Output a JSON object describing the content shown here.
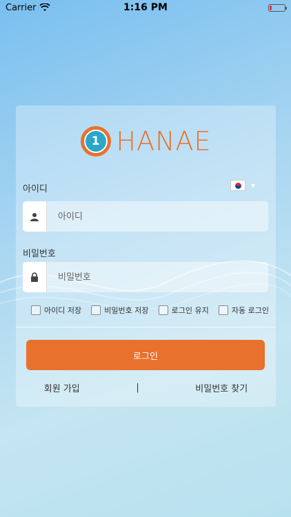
{
  "status_bar": {
    "carrier": "Carrier",
    "time": "1:16 PM",
    "wifi_icon": "wifi-icon",
    "battery_icon": "battery-icon"
  },
  "logo": {
    "number": "1",
    "text": "HANAE"
  },
  "form": {
    "id_label": "아이디",
    "id_placeholder": "아이디",
    "pw_label": "비밀번호",
    "pw_placeholder": "비밀번호",
    "language_icon": "korea-flag-icon"
  },
  "options": [
    {
      "label": "아이디 저장",
      "checked": false
    },
    {
      "label": "비밀번호 저장",
      "checked": false
    },
    {
      "label": "로그인 유지",
      "checked": false
    },
    {
      "label": "자동 로그인",
      "checked": false
    }
  ],
  "login_button": "로그인",
  "links": {
    "signup": "회원 가입",
    "separator": "|",
    "find_password": "비밀번호 찾기"
  },
  "colors": {
    "accent": "#e8712d",
    "logo_circle_inner": "#2aa6c9"
  }
}
